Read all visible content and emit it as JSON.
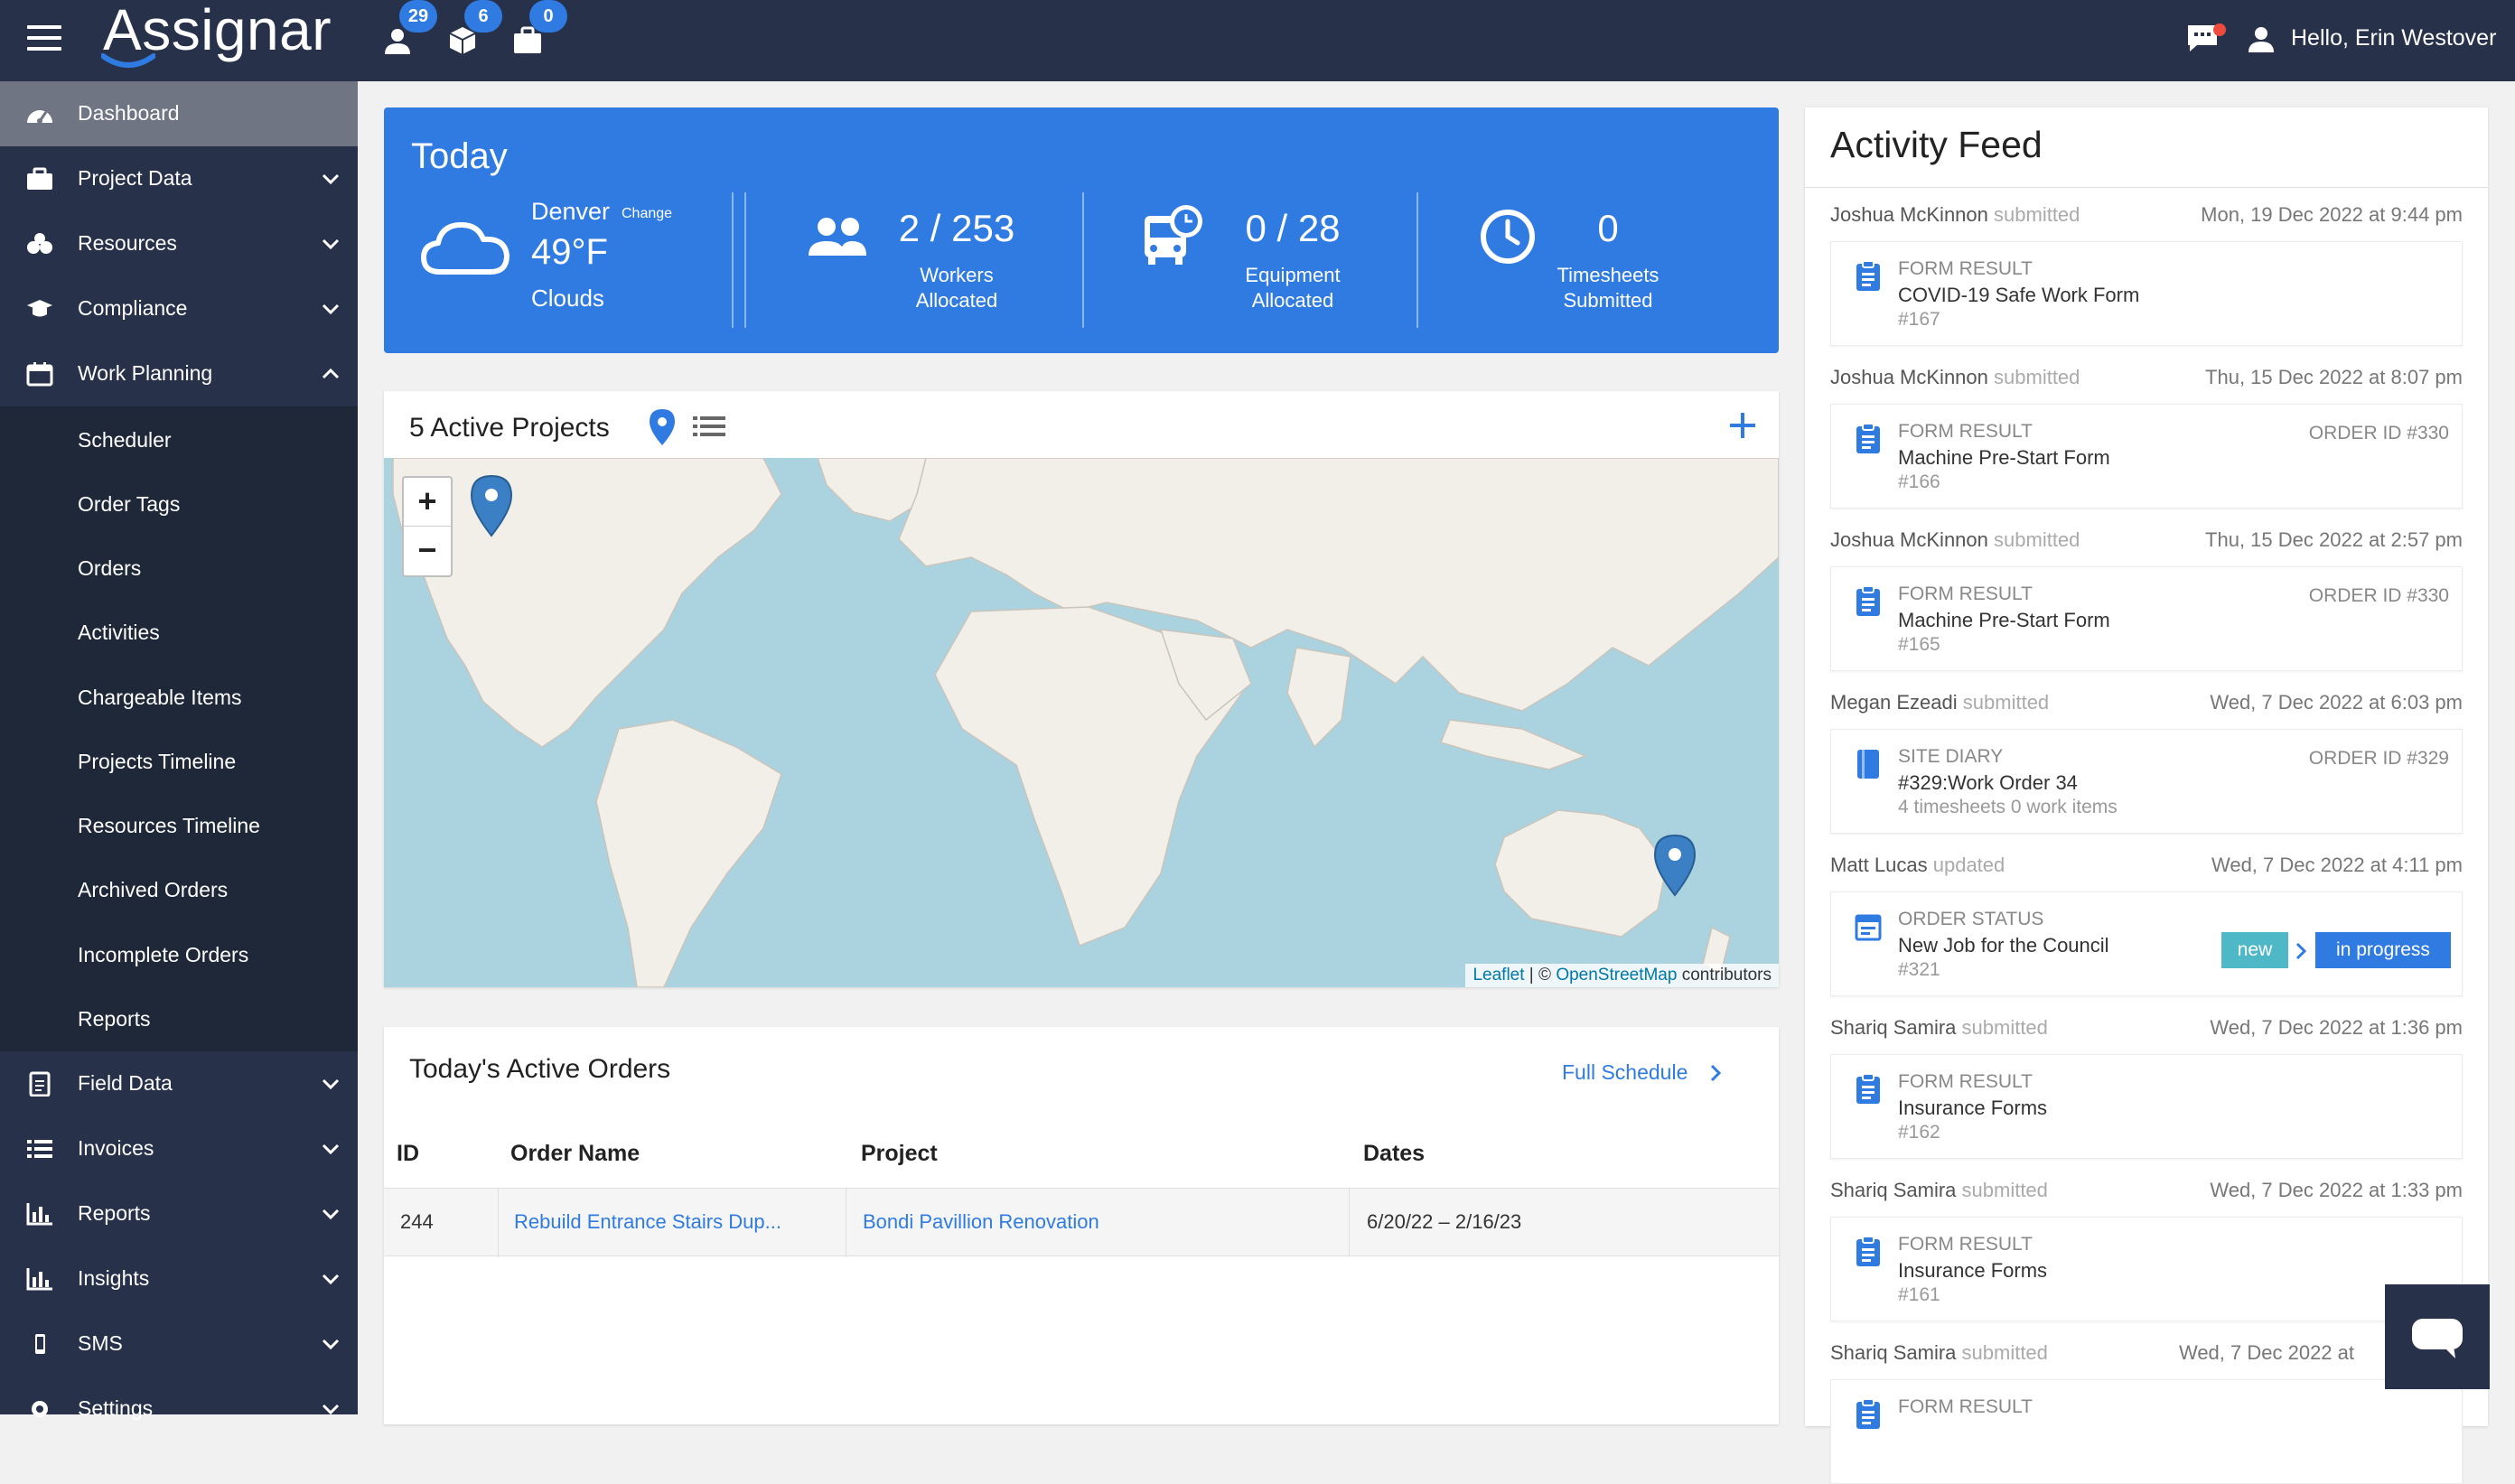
{
  "app": {
    "logo": "Assignar",
    "greeting": "Hello, Erin Westover"
  },
  "topbar": {
    "badges": {
      "people": "29",
      "box": "6",
      "bag": "0"
    }
  },
  "sidebar": {
    "items": [
      {
        "label": "Dashboard",
        "icon": "dashboard-icon"
      },
      {
        "label": "Project Data",
        "icon": "briefcase-icon"
      },
      {
        "label": "Resources",
        "icon": "resources-icon"
      },
      {
        "label": "Compliance",
        "icon": "graduation-cap-icon"
      },
      {
        "label": "Work Planning",
        "icon": "calendar-icon"
      }
    ],
    "work_planning_sub": [
      "Scheduler",
      "Order Tags",
      "Orders",
      "Activities",
      "Chargeable Items",
      "Projects Timeline",
      "Resources Timeline",
      "Archived Orders",
      "Incomplete Orders",
      "Reports"
    ],
    "items_bottom": [
      {
        "label": "Field Data",
        "icon": "clipboard-icon"
      },
      {
        "label": "Invoices",
        "icon": "list-icon"
      },
      {
        "label": "Reports",
        "icon": "bar-chart-icon"
      },
      {
        "label": "Insights",
        "icon": "bar-chart-icon"
      },
      {
        "label": "SMS",
        "icon": "phone-icon"
      },
      {
        "label": "Settings",
        "icon": "gear-icon"
      }
    ]
  },
  "today": {
    "title": "Today",
    "city": "Denver",
    "change": "Change",
    "temp": "49°F",
    "condition": "Clouds",
    "workers": {
      "value": "2 / 253",
      "label1": "Workers",
      "label2": "Allocated"
    },
    "equipment": {
      "value": "0 / 28",
      "label1": "Equipment",
      "label2": "Allocated"
    },
    "timesheets": {
      "value": "0",
      "label1": "Timesheets",
      "label2": "Submitted"
    }
  },
  "projects": {
    "title": "5 Active Projects",
    "zoom_in": "+",
    "zoom_out": "−",
    "attrib_leaflet": "Leaflet",
    "attrib_sep": " | © ",
    "attrib_osm": "OpenStreetMap",
    "attrib_rest": " contributors"
  },
  "orders": {
    "title": "Today's Active Orders",
    "full_schedule": "Full Schedule",
    "columns": [
      "ID",
      "Order Name",
      "Project",
      "Dates"
    ],
    "rows": [
      {
        "id": "244",
        "name": "Rebuild Entrance Stairs Dup...",
        "project": "Bondi Pavillion Renovation",
        "dates": "6/20/22 – 2/16/23"
      }
    ]
  },
  "feed": {
    "title": "Activity Feed",
    "entries": [
      {
        "who": "Joshua McKinnon",
        "action": "submitted",
        "when": "Mon, 19 Dec 2022 at 9:44 pm",
        "type": "FORM RESULT",
        "name": "COVID-19 Safe Work Form",
        "num": "#167",
        "order": ""
      },
      {
        "who": "Joshua McKinnon",
        "action": "submitted",
        "when": "Thu, 15 Dec 2022 at 8:07 pm",
        "type": "FORM RESULT",
        "name": "Machine Pre-Start Form",
        "num": "#166",
        "order": "ORDER ID #330"
      },
      {
        "who": "Joshua McKinnon",
        "action": "submitted",
        "when": "Thu, 15 Dec 2022 at 2:57 pm",
        "type": "FORM RESULT",
        "name": "Machine Pre-Start Form",
        "num": "#165",
        "order": "ORDER ID #330"
      },
      {
        "who": "Megan Ezeadi",
        "action": "submitted",
        "when": "Wed, 7 Dec 2022 at 6:03 pm",
        "type": "SITE DIARY",
        "name": "#329:Work Order 34",
        "num": "4 timesheets 0 work items",
        "order": "ORDER ID #329"
      },
      {
        "who": "Matt Lucas",
        "action": "updated",
        "when": "Wed, 7 Dec 2022 at 4:11 pm",
        "type": "ORDER STATUS",
        "name": "New Job for the Council",
        "num": "#321",
        "order": "",
        "from": "new",
        "to": "in progress"
      },
      {
        "who": "Shariq Samira",
        "action": "submitted",
        "when": "Wed, 7 Dec 2022 at 1:36 pm",
        "type": "FORM RESULT",
        "name": "Insurance Forms",
        "num": "#162",
        "order": ""
      },
      {
        "who": "Shariq Samira",
        "action": "submitted",
        "when": "Wed, 7 Dec 2022 at 1:33 pm",
        "type": "FORM RESULT",
        "name": "Insurance Forms",
        "num": "#161",
        "order": ""
      },
      {
        "who": "Shariq Samira",
        "action": "submitted",
        "when": "Wed, 7 Dec 2022 at",
        "type": "FORM RESULT",
        "name": "",
        "num": "",
        "order": ""
      }
    ]
  }
}
